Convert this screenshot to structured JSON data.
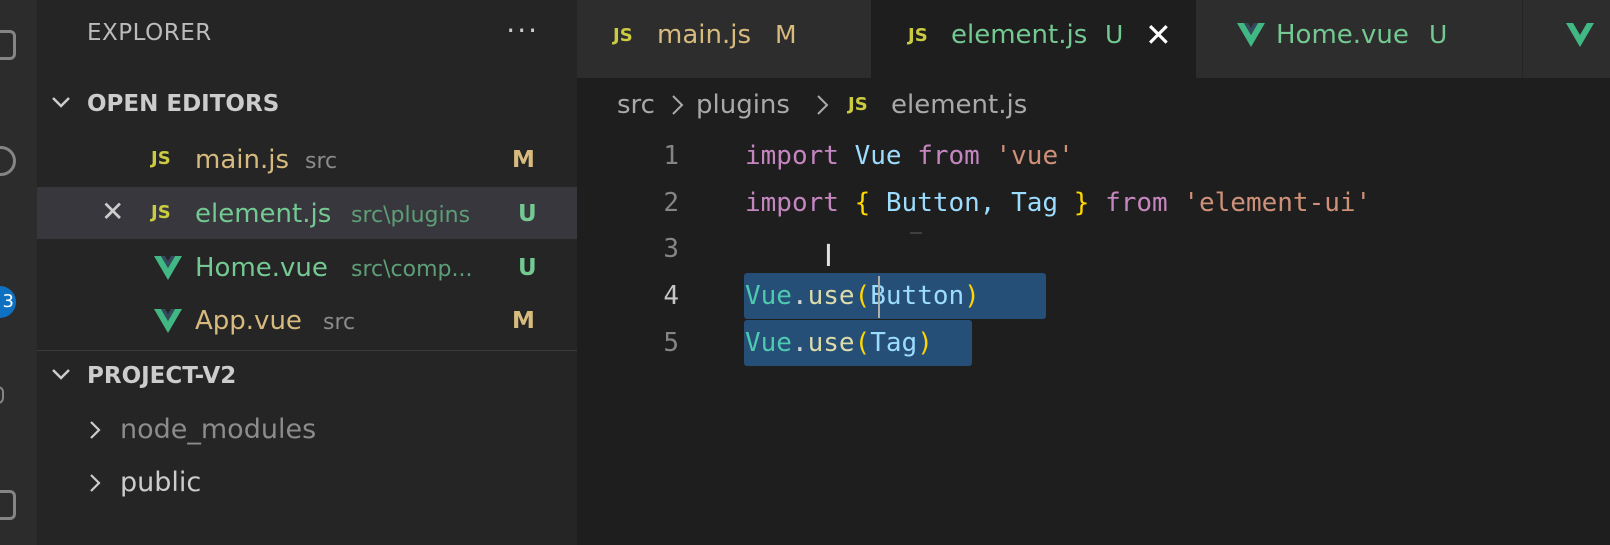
{
  "sidebar": {
    "title": "EXPLORER",
    "more": "···",
    "open_editors": {
      "title": "OPEN EDITORS",
      "items": [
        {
          "icon": "JS",
          "name": "main.js",
          "path": "src",
          "status": "M"
        },
        {
          "icon": "JS",
          "name": "element.js",
          "path": "src\\plugins",
          "status": "U",
          "close": "✕"
        },
        {
          "icon": "vue-icon",
          "name": "Home.vue",
          "path": "src\\comp...",
          "status": "U"
        },
        {
          "icon": "vue-icon",
          "name": "App.vue",
          "path": "src",
          "status": "M"
        }
      ]
    },
    "project": {
      "title": "PROJECT-V2",
      "folders": [
        "node_modules",
        "public"
      ]
    }
  },
  "activity_bar": {
    "badge": "3"
  },
  "tabs": [
    {
      "icon": "JS",
      "label": "main.js",
      "status": "M"
    },
    {
      "icon": "JS",
      "label": "element.js",
      "status": "U",
      "close": "✕"
    },
    {
      "icon": "vue-icon",
      "label": "Home.vue",
      "status": "U"
    }
  ],
  "breadcrumb": {
    "icon": "JS",
    "items": [
      "src",
      "plugins",
      "element.js"
    ]
  },
  "editor": {
    "line_numbers": [
      "1",
      "2",
      "3",
      "4",
      "5"
    ],
    "lines": {
      "l1": {
        "kw1": "import",
        "id": "Vue",
        "kw2": "from",
        "str": "'vue'"
      },
      "l2": {
        "kw1": "import",
        "lb": "{",
        "a": "Button,",
        "b": "Tag",
        "rb": "}",
        "kw2": "from",
        "str": "'element-ui'"
      },
      "l4": {
        "cls": "Vue",
        "dot": ".",
        "fn": "use",
        "lp": "(",
        "arg": "Button",
        "rp": ")"
      },
      "l5": {
        "cls": "Vue",
        "dot": ".",
        "fn": "use",
        "lp": "(",
        "arg": "Tag",
        "rp": ")"
      }
    },
    "cursor_glyph": "I"
  },
  "colors": {
    "modified": "#d7ba7d",
    "untracked": "#73c991",
    "js_icon": "#cbcb41",
    "vue_icon": "#41b883",
    "selection": "#264f78"
  }
}
